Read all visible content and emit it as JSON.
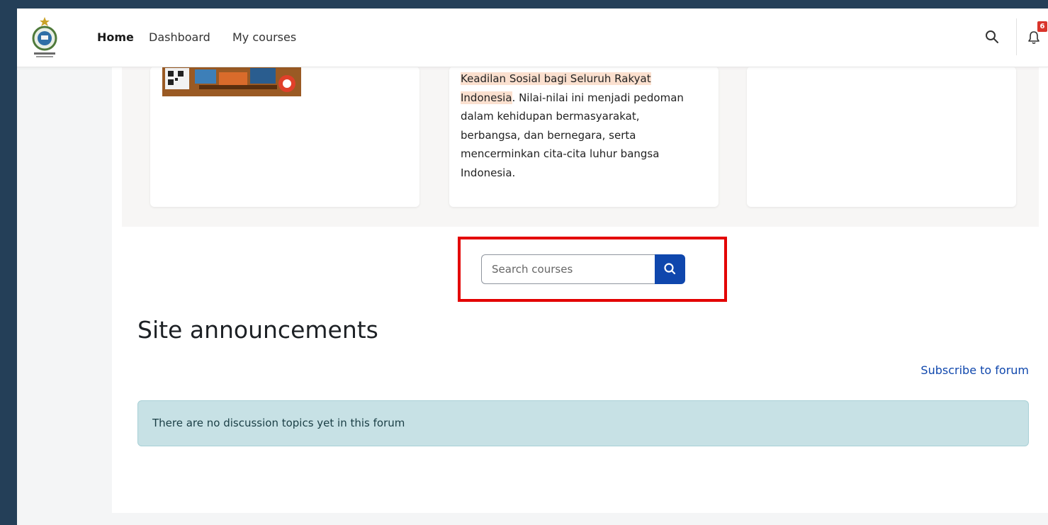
{
  "nav": {
    "home": "Home",
    "dashboard": "Dashboard",
    "my_courses": "My courses",
    "notification_count": "6",
    "icons": [
      "search-icon",
      "bell-icon"
    ]
  },
  "cards": {
    "course_2": {
      "highlight_text": "Keadilan Sosial bagi Seluruh Rakyat Indonesia",
      "body_text": ". Nilai-nilai ini menjadi pedoman dalam kehidupan bermasyarakat, berbangsa, dan bernegara, serta mencerminkan cita-cita luhur bangsa Indonesia."
    }
  },
  "search": {
    "placeholder": "Search courses"
  },
  "announcements": {
    "title": "Site announcements",
    "subscribe_link": "Subscribe to forum",
    "empty_message": "There are no discussion topics yet in this forum"
  },
  "colors": {
    "page_background": "#243f58",
    "primary": "#0f47ad",
    "highlight_box": "#e30000",
    "alert_background": "#c7e1e5",
    "text_highlight": "#fbe0cf"
  }
}
